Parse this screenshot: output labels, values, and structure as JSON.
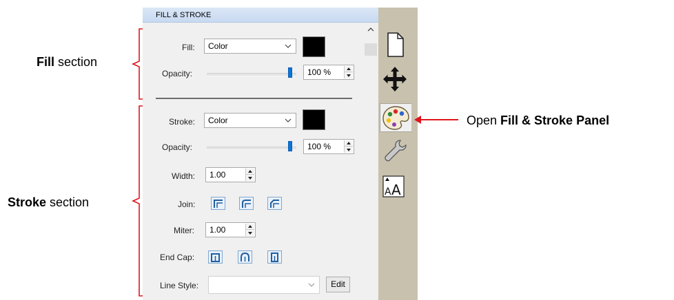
{
  "panel_title": "FILL & STROKE",
  "callouts": {
    "fill": {
      "bold": "Fill",
      "rest": " section"
    },
    "stroke": {
      "bold": "Stroke",
      "rest": " section"
    },
    "open_panel": {
      "prefix": "Open ",
      "bold": "Fill & Stroke Panel"
    }
  },
  "fill": {
    "label": "Fill:",
    "type": "Color",
    "color": "#000000",
    "opacity_label": "Opacity:",
    "opacity_value": "100 %",
    "opacity_fraction": 1.0
  },
  "stroke": {
    "label": "Stroke:",
    "type": "Color",
    "color": "#000000",
    "opacity_label": "Opacity:",
    "opacity_value": "100 %",
    "opacity_fraction": 1.0,
    "width_label": "Width:",
    "width_value": "1.00",
    "join_label": "Join:",
    "join_options": [
      "miter-join-icon",
      "round-join-icon",
      "bevel-join-icon"
    ],
    "miter_label": "Miter:",
    "miter_value": "1.00",
    "endcap_label": "End Cap:",
    "endcap_options": [
      "butt-cap-icon",
      "round-cap-icon",
      "square-cap-icon"
    ],
    "linestyle_label": "Line Style:",
    "linestyle_value": "",
    "edit_label": "Edit"
  },
  "sidebar_tabs": [
    {
      "icon": "document-icon",
      "active": false
    },
    {
      "icon": "move-arrows-icon",
      "active": false
    },
    {
      "icon": "palette-icon",
      "active": true
    },
    {
      "icon": "wrench-icon",
      "active": false
    },
    {
      "icon": "text-size-icon",
      "active": false
    }
  ],
  "colors": {
    "accent_red": "#e0141c",
    "title_bar": "#c7d9f1",
    "slider_thumb": "#0d74d6",
    "sidebar": "#c7c1ae"
  }
}
